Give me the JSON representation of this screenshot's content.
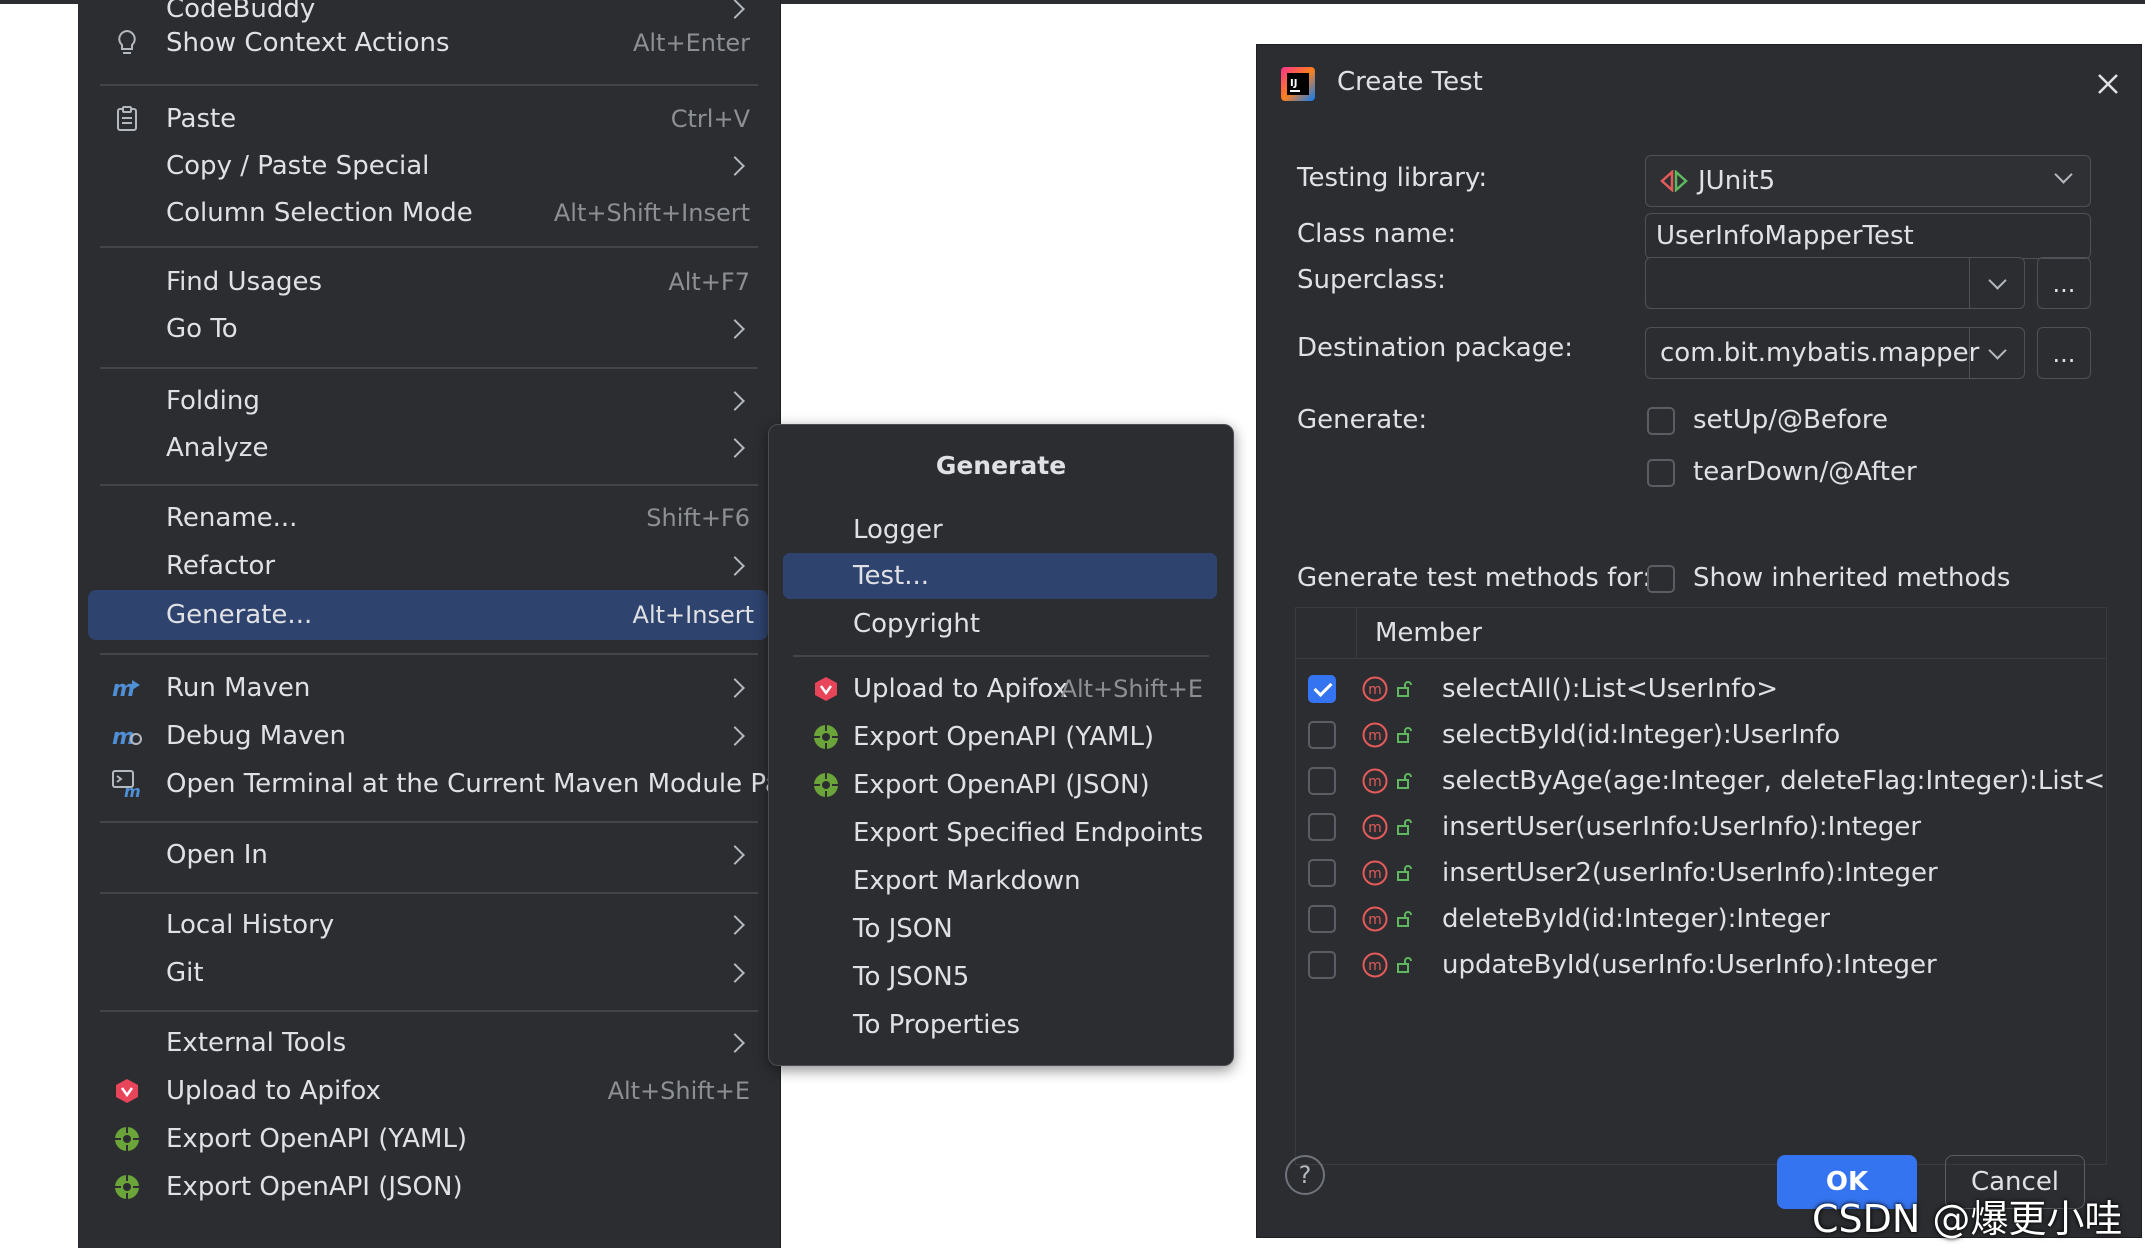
{
  "context_menu": {
    "items": [
      {
        "label": "CodeBuddy",
        "shortcut": "",
        "submenu": true
      },
      {
        "label": "Show Context Actions",
        "shortcut": "Alt+Enter",
        "icon": "lightbulb-icon"
      },
      {
        "label": "Paste",
        "shortcut": "Ctrl+V",
        "icon": "clipboard-icon"
      },
      {
        "label": "Copy / Paste Special",
        "shortcut": "",
        "submenu": true
      },
      {
        "label": "Column Selection Mode",
        "shortcut": "Alt+Shift+Insert"
      },
      {
        "label": "Find Usages",
        "shortcut": "Alt+F7"
      },
      {
        "label": "Go To",
        "shortcut": "",
        "submenu": true
      },
      {
        "label": "Folding",
        "shortcut": "",
        "submenu": true
      },
      {
        "label": "Analyze",
        "shortcut": "",
        "submenu": true
      },
      {
        "label": "Rename...",
        "shortcut": "Shift+F6"
      },
      {
        "label": "Refactor",
        "shortcut": "",
        "submenu": true
      },
      {
        "label": "Generate...",
        "shortcut": "Alt+Insert",
        "selected": true
      },
      {
        "label": "Run Maven",
        "shortcut": "",
        "submenu": true,
        "icon": "maven-run-icon"
      },
      {
        "label": "Debug Maven",
        "shortcut": "",
        "submenu": true,
        "icon": "maven-debug-icon"
      },
      {
        "label": "Open Terminal at the Current Maven Module Path",
        "shortcut": "",
        "icon": "maven-terminal-icon"
      },
      {
        "label": "Open In",
        "shortcut": "",
        "submenu": true
      },
      {
        "label": "Local History",
        "shortcut": "",
        "submenu": true
      },
      {
        "label": "Git",
        "shortcut": "",
        "submenu": true
      },
      {
        "label": "External Tools",
        "shortcut": "",
        "submenu": true
      },
      {
        "label": "Upload to Apifox",
        "shortcut": "Alt+Shift+E",
        "icon": "apifox-icon"
      },
      {
        "label": "Export OpenAPI (YAML)",
        "shortcut": "",
        "icon": "openapi-icon"
      },
      {
        "label": "Export OpenAPI (JSON)",
        "shortcut": "",
        "icon": "openapi-icon"
      }
    ]
  },
  "generate_menu": {
    "title": "Generate",
    "items": [
      {
        "label": "Logger"
      },
      {
        "label": "Test...",
        "selected": true
      },
      {
        "label": "Copyright"
      },
      {
        "label": "Upload to Apifox",
        "shortcut": "Alt+Shift+E",
        "icon": "apifox-icon"
      },
      {
        "label": "Export OpenAPI (YAML)",
        "icon": "openapi-icon"
      },
      {
        "label": "Export OpenAPI (JSON)",
        "icon": "openapi-icon"
      },
      {
        "label": "Export Specified Endpoints"
      },
      {
        "label": "Export Markdown"
      },
      {
        "label": "To JSON"
      },
      {
        "label": "To JSON5"
      },
      {
        "label": "To Properties"
      }
    ]
  },
  "dialog": {
    "title": "Create Test",
    "testing_library_label": "Testing library:",
    "testing_library_value": "JUnit5",
    "class_name_label": "Class name:",
    "class_name_value": "UserInfoMapperTest",
    "superclass_label": "Superclass:",
    "superclass_value": "",
    "destination_label": "Destination package:",
    "destination_value": "com.bit.mybatis.mapper",
    "ellipsis": "...",
    "generate_label": "Generate:",
    "setup_label": "setUp/@Before",
    "teardown_label": "tearDown/@After",
    "methods_for_label": "Generate test methods for:",
    "show_inherited_label": "Show inherited methods",
    "member_header": "Member",
    "members": [
      {
        "signature": "selectAll():List<UserInfo>",
        "checked": true
      },
      {
        "signature": "selectById(id:Integer):UserInfo",
        "checked": false
      },
      {
        "signature": "selectByAge(age:Integer, deleteFlag:Integer):List<UserI",
        "checked": false
      },
      {
        "signature": "insertUser(userInfo:UserInfo):Integer",
        "checked": false
      },
      {
        "signature": "insertUser2(userInfo:UserInfo):Integer",
        "checked": false
      },
      {
        "signature": "deleteById(id:Integer):Integer",
        "checked": false
      },
      {
        "signature": "updateById(userInfo:UserInfo):Integer",
        "checked": false
      }
    ],
    "help": "?",
    "ok": "OK",
    "cancel": "Cancel"
  },
  "watermark": "CSDN @爆更小哇",
  "colors": {
    "menu_bg": "#2b2d30",
    "selection": "#2e436e",
    "accent": "#3574f0",
    "method_icon": "#e55b5b",
    "lock_icon": "#5fb85f"
  }
}
